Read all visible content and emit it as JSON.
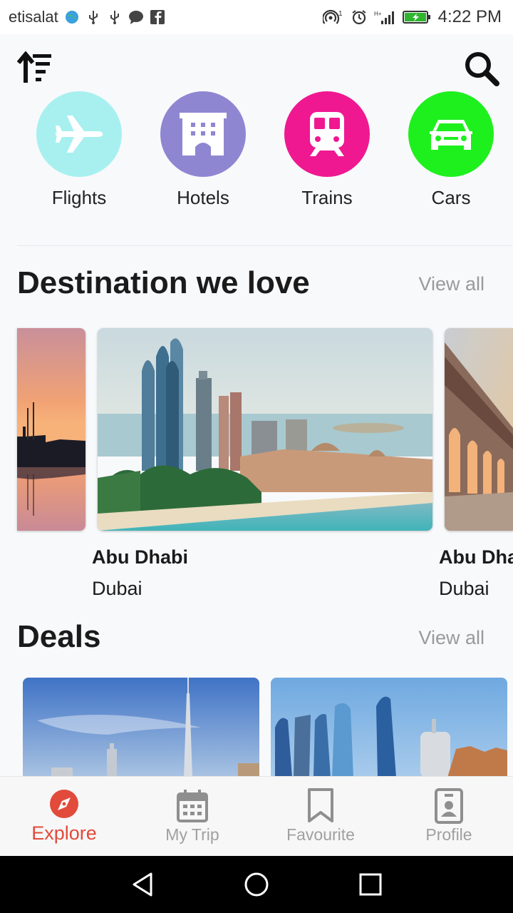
{
  "status_bar": {
    "carrier": "etisalat",
    "time": "4:22 PM"
  },
  "toolbar": {
    "sort_icon": "sort-ascending-icon",
    "search_icon": "search-icon"
  },
  "categories": [
    {
      "label": "Flights",
      "icon": "airplane-icon",
      "color": "#a8f0f0"
    },
    {
      "label": "Hotels",
      "icon": "hotel-icon",
      "color": "#8f86d2"
    },
    {
      "label": "Trains",
      "icon": "train-icon",
      "color": "#ef1891"
    },
    {
      "label": "Cars",
      "icon": "car-icon",
      "color": "#1ef01e"
    }
  ],
  "destinations": {
    "title": "Destination we love",
    "view_all": "View all",
    "items": [
      {
        "name": "",
        "city": ""
      },
      {
        "name": "Abu Dhabi",
        "city": "Dubai"
      },
      {
        "name": "Abu Dha",
        "city": "Dubai"
      }
    ]
  },
  "deals": {
    "title": "Deals",
    "view_all": "View all"
  },
  "bottom_nav": {
    "items": [
      {
        "label": "Explore",
        "icon": "compass-icon",
        "active": true
      },
      {
        "label": "My Trip",
        "icon": "calendar-icon",
        "active": false
      },
      {
        "label": "Favourite",
        "icon": "bookmark-icon",
        "active": false
      },
      {
        "label": "Profile",
        "icon": "profile-card-icon",
        "active": false
      }
    ]
  },
  "colors": {
    "accent": "#e24a3b",
    "inactive": "#a0a0a0",
    "background": "#f8f9fb"
  }
}
